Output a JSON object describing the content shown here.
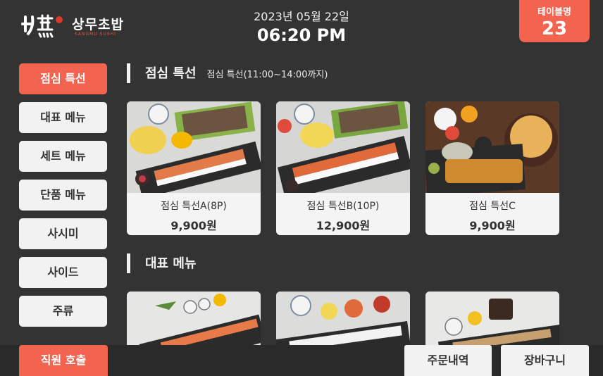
{
  "header": {
    "logo_text": "상무초밥",
    "logo_sub": "SANGMU SUSHI",
    "date": "2023년 05월 22일",
    "time": "06:20 PM",
    "table_label": "테이블명",
    "table_number": "23"
  },
  "sidebar": {
    "items": [
      {
        "label": "점심 특선",
        "active": true
      },
      {
        "label": "대표 메뉴"
      },
      {
        "label": "세트 메뉴"
      },
      {
        "label": "단품 메뉴"
      },
      {
        "label": "사시미"
      },
      {
        "label": "사이드"
      },
      {
        "label": "주류"
      }
    ]
  },
  "sections": [
    {
      "title": "점심 특선",
      "subtitle": "점심 특선(11:00~14:00까지)",
      "items": [
        {
          "name": "점심 특선A(8P)",
          "price": "9,900원"
        },
        {
          "name": "점심 특선B(10P)",
          "price": "12,900원"
        },
        {
          "name": "점심 특선C",
          "price": "9,900원"
        }
      ]
    },
    {
      "title": "대표 메뉴",
      "subtitle": ""
    }
  ],
  "bottom": {
    "call_label": "직원 호출",
    "orders_label": "주문내역",
    "cart_label": "장바구니"
  },
  "colors": {
    "accent": "#f26350",
    "background": "#333333",
    "button": "#f2f2f2"
  }
}
